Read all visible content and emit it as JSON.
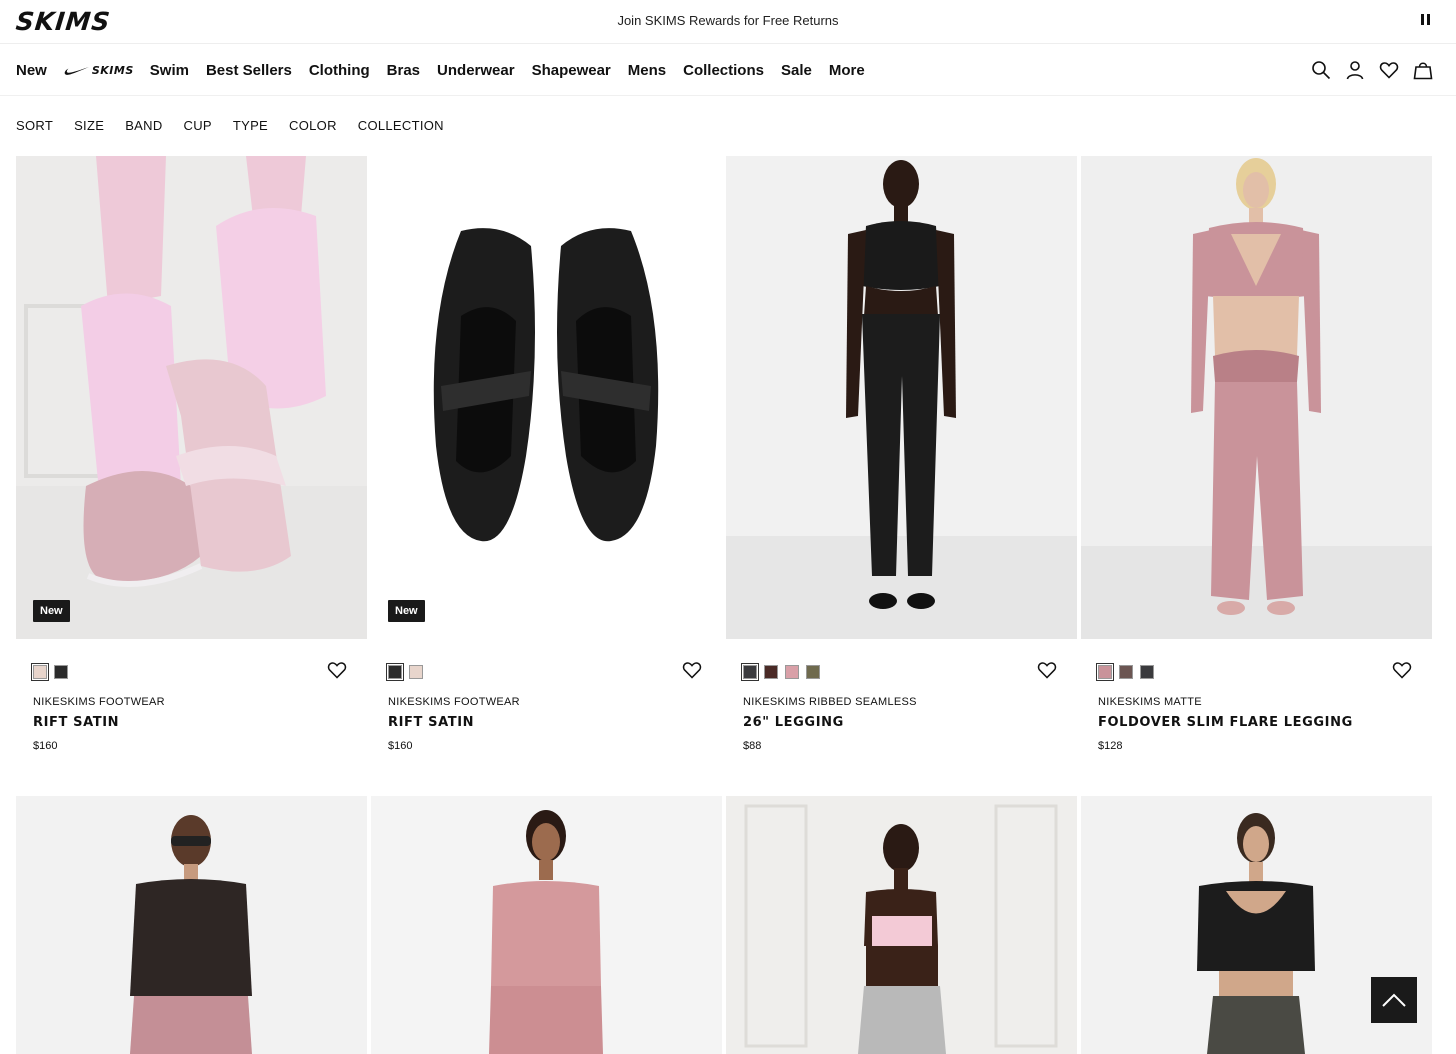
{
  "brand": {
    "logo": "SKIMS"
  },
  "promo": {
    "text": "Join SKIMS Rewards for Free Returns"
  },
  "nav": {
    "items_before": [
      "New"
    ],
    "collab_logo": "SKIMS",
    "items_after": [
      "Swim",
      "Best Sellers",
      "Clothing",
      "Bras",
      "Underwear",
      "Shapewear",
      "Mens",
      "Collections",
      "Sale",
      "More"
    ],
    "icons": [
      "search-icon",
      "account-icon",
      "wishlist-icon",
      "bag-icon"
    ]
  },
  "filters": [
    "SORT",
    "SIZE",
    "BAND",
    "CUP",
    "TYPE",
    "COLOR",
    "COLLECTION"
  ],
  "products": [
    {
      "badge": "New",
      "collection": "NIKESKIMS FOOTWEAR",
      "name": "RIFT SATIN",
      "price": "$160",
      "swatches": [
        "#e8d5cc",
        "#2b2b2b"
      ]
    },
    {
      "badge": "New",
      "collection": "NIKESKIMS FOOTWEAR",
      "name": "RIFT SATIN",
      "price": "$160",
      "swatches": [
        "#2b2b2b",
        "#e8d5cc"
      ]
    },
    {
      "badge": "",
      "collection": "NIKESKIMS RIBBED SEAMLESS",
      "name": "26\" LEGGING",
      "price": "$88",
      "swatches": [
        "#3a3a3d",
        "#4a2a26",
        "#d9a0a8",
        "#6f6a4e"
      ]
    },
    {
      "badge": "",
      "collection": "NIKESKIMS MATTE",
      "name": "FOLDOVER SLIM FLARE LEGGING",
      "price": "$128",
      "swatches": [
        "#c9939a",
        "#6b5552",
        "#3a3a3d"
      ]
    }
  ],
  "colors": {
    "badge_bg": "#1a1a1a",
    "text": "#111111"
  }
}
